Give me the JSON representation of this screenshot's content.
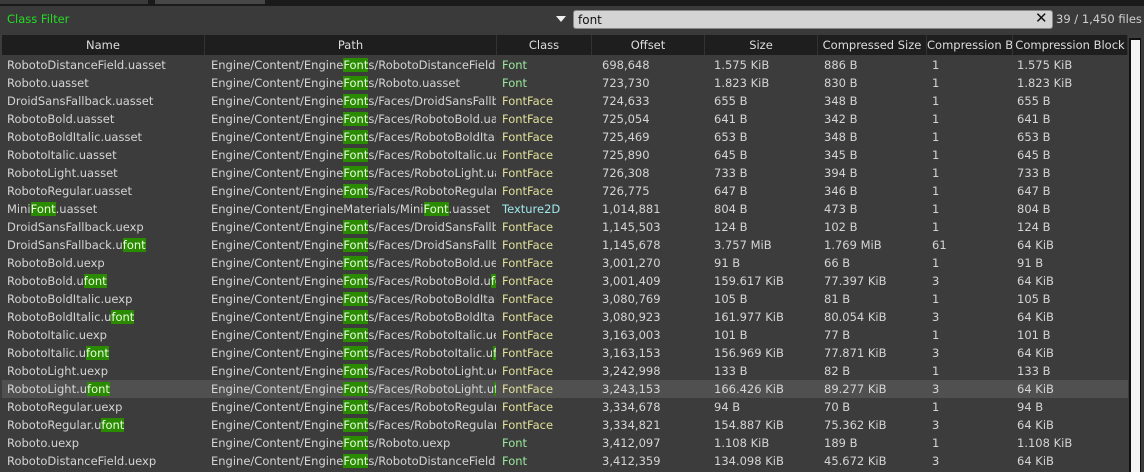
{
  "filter": {
    "class_filter_label": "Class Filter",
    "search_value": "font",
    "file_count": "39 / 1,450 files"
  },
  "colors": {
    "highlight": "#2a8a00",
    "class_Font": "#9be89b",
    "class_FontFace": "#e0e09a",
    "class_Texture2D": "#9fe8ee",
    "class_filter": "#22dd22"
  },
  "columns": [
    "Name",
    "Path",
    "Class",
    "Offset",
    "Size",
    "Compressed Size",
    "Compression B",
    "Compression Block"
  ],
  "selected_row": 18,
  "rows": [
    {
      "name": "RobotoDistanceField.uasset",
      "path": "Engine/Content/EngineFonts/RobotoDistanceField.uasset",
      "class": "Font",
      "offset": "698,648",
      "size": "1.575 KiB",
      "csize": "886 B",
      "cb": "1",
      "block": "1.575 KiB"
    },
    {
      "name": "Roboto.uasset",
      "path": "Engine/Content/EngineFonts/Roboto.uasset",
      "class": "Font",
      "offset": "723,730",
      "size": "1.823 KiB",
      "csize": "830 B",
      "cb": "1",
      "block": "1.823 KiB"
    },
    {
      "name": "DroidSansFallback.uasset",
      "path": "Engine/Content/EngineFonts/Faces/DroidSansFallback.uasset",
      "class": "FontFace",
      "offset": "724,633",
      "size": "655 B",
      "csize": "348 B",
      "cb": "1",
      "block": "655 B"
    },
    {
      "name": "RobotoBold.uasset",
      "path": "Engine/Content/EngineFonts/Faces/RobotoBold.uasset",
      "class": "FontFace",
      "offset": "725,054",
      "size": "641 B",
      "csize": "342 B",
      "cb": "1",
      "block": "641 B"
    },
    {
      "name": "RobotoBoldItalic.uasset",
      "path": "Engine/Content/EngineFonts/Faces/RobotoBoldItalic.uasset",
      "class": "FontFace",
      "offset": "725,469",
      "size": "653 B",
      "csize": "348 B",
      "cb": "1",
      "block": "653 B"
    },
    {
      "name": "RobotoItalic.uasset",
      "path": "Engine/Content/EngineFonts/Faces/RobotoItalic.uasset",
      "class": "FontFace",
      "offset": "725,890",
      "size": "645 B",
      "csize": "345 B",
      "cb": "1",
      "block": "645 B"
    },
    {
      "name": "RobotoLight.uasset",
      "path": "Engine/Content/EngineFonts/Faces/RobotoLight.uasset",
      "class": "FontFace",
      "offset": "726,308",
      "size": "733 B",
      "csize": "394 B",
      "cb": "1",
      "block": "733 B"
    },
    {
      "name": "RobotoRegular.uasset",
      "path": "Engine/Content/EngineFonts/Faces/RobotoRegular.uasset",
      "class": "FontFace",
      "offset": "726,775",
      "size": "647 B",
      "csize": "346 B",
      "cb": "1",
      "block": "647 B"
    },
    {
      "name": "MiniFont.uasset",
      "path": "Engine/Content/EngineMaterials/MiniFont.uasset",
      "class": "Texture2D",
      "offset": "1,014,881",
      "size": "804 B",
      "csize": "473 B",
      "cb": "1",
      "block": "804 B"
    },
    {
      "name": "DroidSansFallback.uexp",
      "path": "Engine/Content/EngineFonts/Faces/DroidSansFallback.uexp",
      "class": "FontFace",
      "offset": "1,145,503",
      "size": "124 B",
      "csize": "102 B",
      "cb": "1",
      "block": "124 B"
    },
    {
      "name": "DroidSansFallback.ufont",
      "path": "Engine/Content/EngineFonts/Faces/DroidSansFallback.ufont",
      "class": "FontFace",
      "offset": "1,145,678",
      "size": "3.757 MiB",
      "csize": "1.769 MiB",
      "cb": "61",
      "block": "64 KiB"
    },
    {
      "name": "RobotoBold.uexp",
      "path": "Engine/Content/EngineFonts/Faces/RobotoBold.uexp",
      "class": "FontFace",
      "offset": "3,001,270",
      "size": "91 B",
      "csize": "66 B",
      "cb": "1",
      "block": "91 B"
    },
    {
      "name": "RobotoBold.ufont",
      "path": "Engine/Content/EngineFonts/Faces/RobotoBold.ufont",
      "class": "FontFace",
      "offset": "3,001,409",
      "size": "159.617 KiB",
      "csize": "77.397 KiB",
      "cb": "3",
      "block": "64 KiB"
    },
    {
      "name": "RobotoBoldItalic.uexp",
      "path": "Engine/Content/EngineFonts/Faces/RobotoBoldItalic.uexp",
      "class": "FontFace",
      "offset": "3,080,769",
      "size": "105 B",
      "csize": "81 B",
      "cb": "1",
      "block": "105 B"
    },
    {
      "name": "RobotoBoldItalic.ufont",
      "path": "Engine/Content/EngineFonts/Faces/RobotoBoldItalic.ufont",
      "class": "FontFace",
      "offset": "3,080,923",
      "size": "161.977 KiB",
      "csize": "80.054 KiB",
      "cb": "3",
      "block": "64 KiB"
    },
    {
      "name": "RobotoItalic.uexp",
      "path": "Engine/Content/EngineFonts/Faces/RobotoItalic.uexp",
      "class": "FontFace",
      "offset": "3,163,003",
      "size": "101 B",
      "csize": "77 B",
      "cb": "1",
      "block": "101 B"
    },
    {
      "name": "RobotoItalic.ufont",
      "path": "Engine/Content/EngineFonts/Faces/RobotoItalic.ufont",
      "class": "FontFace",
      "offset": "3,163,153",
      "size": "156.969 KiB",
      "csize": "77.871 KiB",
      "cb": "3",
      "block": "64 KiB"
    },
    {
      "name": "RobotoLight.uexp",
      "path": "Engine/Content/EngineFonts/Faces/RobotoLight.uexp",
      "class": "FontFace",
      "offset": "3,242,998",
      "size": "133 B",
      "csize": "82 B",
      "cb": "1",
      "block": "133 B"
    },
    {
      "name": "RobotoLight.ufont",
      "path": "Engine/Content/EngineFonts/Faces/RobotoLight.ufont",
      "class": "FontFace",
      "offset": "3,243,153",
      "size": "166.426 KiB",
      "csize": "89.277 KiB",
      "cb": "3",
      "block": "64 KiB"
    },
    {
      "name": "RobotoRegular.uexp",
      "path": "Engine/Content/EngineFonts/Faces/RobotoRegular.uexp",
      "class": "FontFace",
      "offset": "3,334,678",
      "size": "94 B",
      "csize": "70 B",
      "cb": "1",
      "block": "94 B"
    },
    {
      "name": "RobotoRegular.ufont",
      "path": "Engine/Content/EngineFonts/Faces/RobotoRegular.ufont",
      "class": "FontFace",
      "offset": "3,334,821",
      "size": "154.887 KiB",
      "csize": "75.362 KiB",
      "cb": "3",
      "block": "64 KiB"
    },
    {
      "name": "Roboto.uexp",
      "path": "Engine/Content/EngineFonts/Roboto.uexp",
      "class": "Font",
      "offset": "3,412,097",
      "size": "1.108 KiB",
      "csize": "189 B",
      "cb": "1",
      "block": "1.108 KiB"
    },
    {
      "name": "RobotoDistanceField.uexp",
      "path": "Engine/Content/EngineFonts/RobotoDistanceField.uexp",
      "class": "Font",
      "offset": "3,412,359",
      "size": "134.098 KiB",
      "csize": "45.672 KiB",
      "cb": "3",
      "block": "64 KiB"
    }
  ]
}
